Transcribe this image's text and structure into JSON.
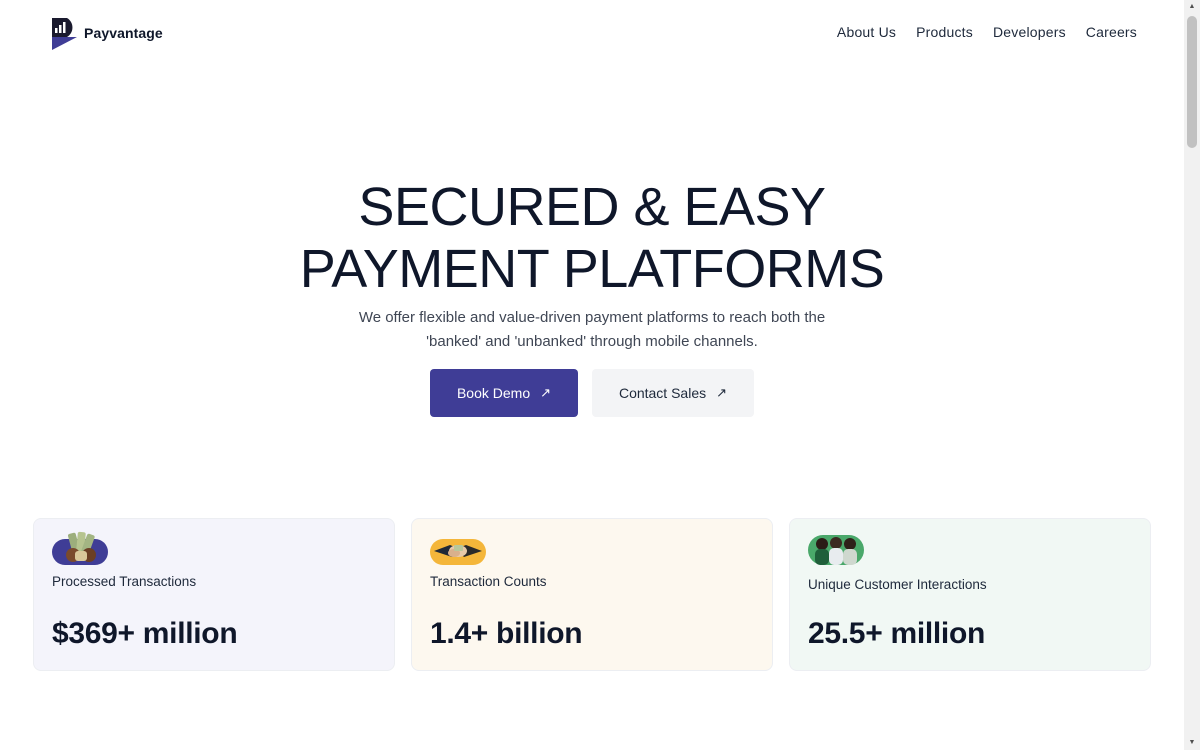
{
  "brand": {
    "name": "Payvantage"
  },
  "nav": {
    "items": [
      "About Us",
      "Products",
      "Developers",
      "Careers"
    ]
  },
  "hero": {
    "title_line1": "SECURED & EASY",
    "title_line2": "PAYMENT PLATFORMS",
    "subtitle": "We offer flexible and value-driven payment platforms to reach both the 'banked' and 'unbanked' through mobile channels."
  },
  "ctas": {
    "primary_label": "Book Demo",
    "secondary_label": "Contact Sales",
    "arrow": "↗"
  },
  "stats": [
    {
      "label": "Processed Transactions",
      "value": "$369+ million",
      "icon": "cash-hands-icon",
      "bg": "#f4f4fb"
    },
    {
      "label": "Transaction Counts",
      "value": "1.4+ billion",
      "icon": "handshake-icon",
      "bg": "#fdf8ef"
    },
    {
      "label": "Unique Customer Interactions",
      "value": "25.5+ million",
      "icon": "customers-icon",
      "bg": "#f1f8f4"
    }
  ],
  "colors": {
    "accent": "#3f3d96",
    "text": "#0f172a"
  }
}
